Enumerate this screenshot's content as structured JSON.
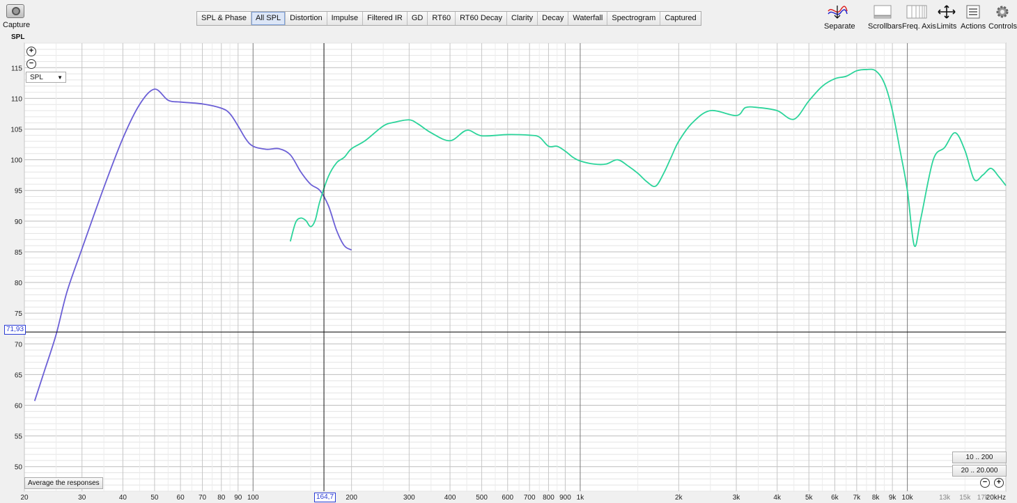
{
  "toolbar_left": {
    "capture_label": "Capture"
  },
  "tabs": [
    "SPL & Phase",
    "All SPL",
    "Distortion",
    "Impulse",
    "Filtered IR",
    "GD",
    "RT60",
    "RT60 Decay",
    "Clarity",
    "Decay",
    "Waterfall",
    "Spectrogram",
    "Captured"
  ],
  "active_tab": "All SPL",
  "toolbar_right": {
    "separate": "Separate",
    "scrollbars": "Scrollbars",
    "freq_axis": "Freq. Axis",
    "limits": "Limits",
    "actions": "Actions",
    "controls": "Controls"
  },
  "plot": {
    "y_axis_title": "SPL",
    "y_ticks": [
      "115",
      "110",
      "105",
      "100",
      "95",
      "90",
      "85",
      "80",
      "75",
      "70",
      "65",
      "60",
      "55",
      "50"
    ],
    "x_ticks": [
      "20",
      "30",
      "40",
      "50",
      "60",
      "70",
      "80",
      "90",
      "100",
      "200",
      "300",
      "400",
      "500",
      "600",
      "700",
      "800",
      "900",
      "1k",
      "2k",
      "3k",
      "4k",
      "5k",
      "6k",
      "7k",
      "8k",
      "9k",
      "10k",
      "13k",
      "15k",
      "17k",
      "20kHz"
    ],
    "selector_value": "SPL",
    "cursor_y": "71,93",
    "cursor_x": "164,7",
    "average_button": "Average the responses",
    "range_buttons": [
      "10 .. 200",
      "20 .. 20.000"
    ]
  },
  "chart_data": {
    "type": "line",
    "xlabel": "",
    "ylabel": "SPL",
    "x_scale": "log",
    "xlim": [
      20,
      20000
    ],
    "ylim": [
      46,
      119
    ],
    "cursor": {
      "x": 164.7,
      "y": 71.93
    },
    "series": [
      {
        "color": "#6b5fd6",
        "x": [
          21.5,
          23,
          25,
          27,
          30,
          35,
          40,
          45,
          50,
          55,
          60,
          70,
          80,
          85,
          90,
          95,
          100,
          110,
          120,
          130,
          140,
          150,
          160,
          170,
          180,
          190,
          200
        ],
        "y": [
          60.7,
          65.5,
          71.5,
          78.5,
          85.5,
          95.5,
          103.5,
          109,
          111.5,
          109.7,
          109.4,
          109.1,
          108.4,
          107.5,
          105.5,
          103.4,
          102.2,
          101.7,
          101.8,
          100.8,
          98,
          96,
          95,
          92.5,
          88.5,
          86,
          85.3
        ]
      },
      {
        "color": "#2bd49a",
        "x": [
          130,
          135,
          140,
          145,
          150,
          155,
          160,
          170,
          180,
          190,
          200,
          220,
          250,
          270,
          300,
          320,
          350,
          400,
          450,
          500,
          600,
          700,
          750,
          800,
          850,
          900,
          950,
          1000,
          1100,
          1200,
          1300,
          1400,
          1500,
          1600,
          1700,
          1800,
          1900,
          2000,
          2200,
          2500,
          3000,
          3200,
          3500,
          4000,
          4500,
          5000,
          5500,
          6000,
          6500,
          7000,
          7500,
          8000,
          8500,
          9000,
          9500,
          10000,
          10500,
          11000,
          12000,
          13000,
          14000,
          15000,
          16000,
          17000,
          18000,
          19000,
          20000
        ],
        "y": [
          86.7,
          89.8,
          90.5,
          90.1,
          89.1,
          90.2,
          93.2,
          97.3,
          99.5,
          100.4,
          101.8,
          103.1,
          105.5,
          106.1,
          106.5,
          105.8,
          104.4,
          103.1,
          104.8,
          103.9,
          104.1,
          104,
          103.7,
          102.2,
          102.2,
          101.4,
          100.4,
          99.8,
          99.3,
          99.3,
          100,
          99,
          97.8,
          96.4,
          95.7,
          97.8,
          100.5,
          103,
          106,
          108,
          107.2,
          108.5,
          108.5,
          108,
          106.6,
          109.6,
          112,
          113.2,
          113.6,
          114.5,
          114.7,
          114.5,
          112.5,
          108,
          101.5,
          95,
          86,
          90.5,
          100,
          102,
          104.4,
          101.5,
          96.8,
          97.5,
          98.6,
          97.3,
          95.8
        ]
      }
    ]
  }
}
